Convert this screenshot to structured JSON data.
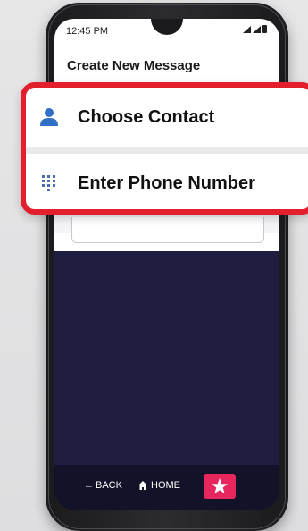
{
  "status_bar": {
    "time": "12:45 PM"
  },
  "header": {
    "title": "Create New Message"
  },
  "menu": {
    "items": [
      {
        "label": "Choose Contact",
        "icon": "person-icon"
      },
      {
        "label": "Enter Phone Number",
        "icon": "dialpad-icon"
      }
    ]
  },
  "nav": {
    "back_label": "BACK",
    "home_label": "HOME",
    "star_icon": "star-icon"
  },
  "colors": {
    "accent": "#e31e2d",
    "star_button": "#e8265e",
    "screen_dark": "#1f1d40",
    "person_icon": "#2f6fc4",
    "dialpad_icon": "#4a6fb0"
  }
}
